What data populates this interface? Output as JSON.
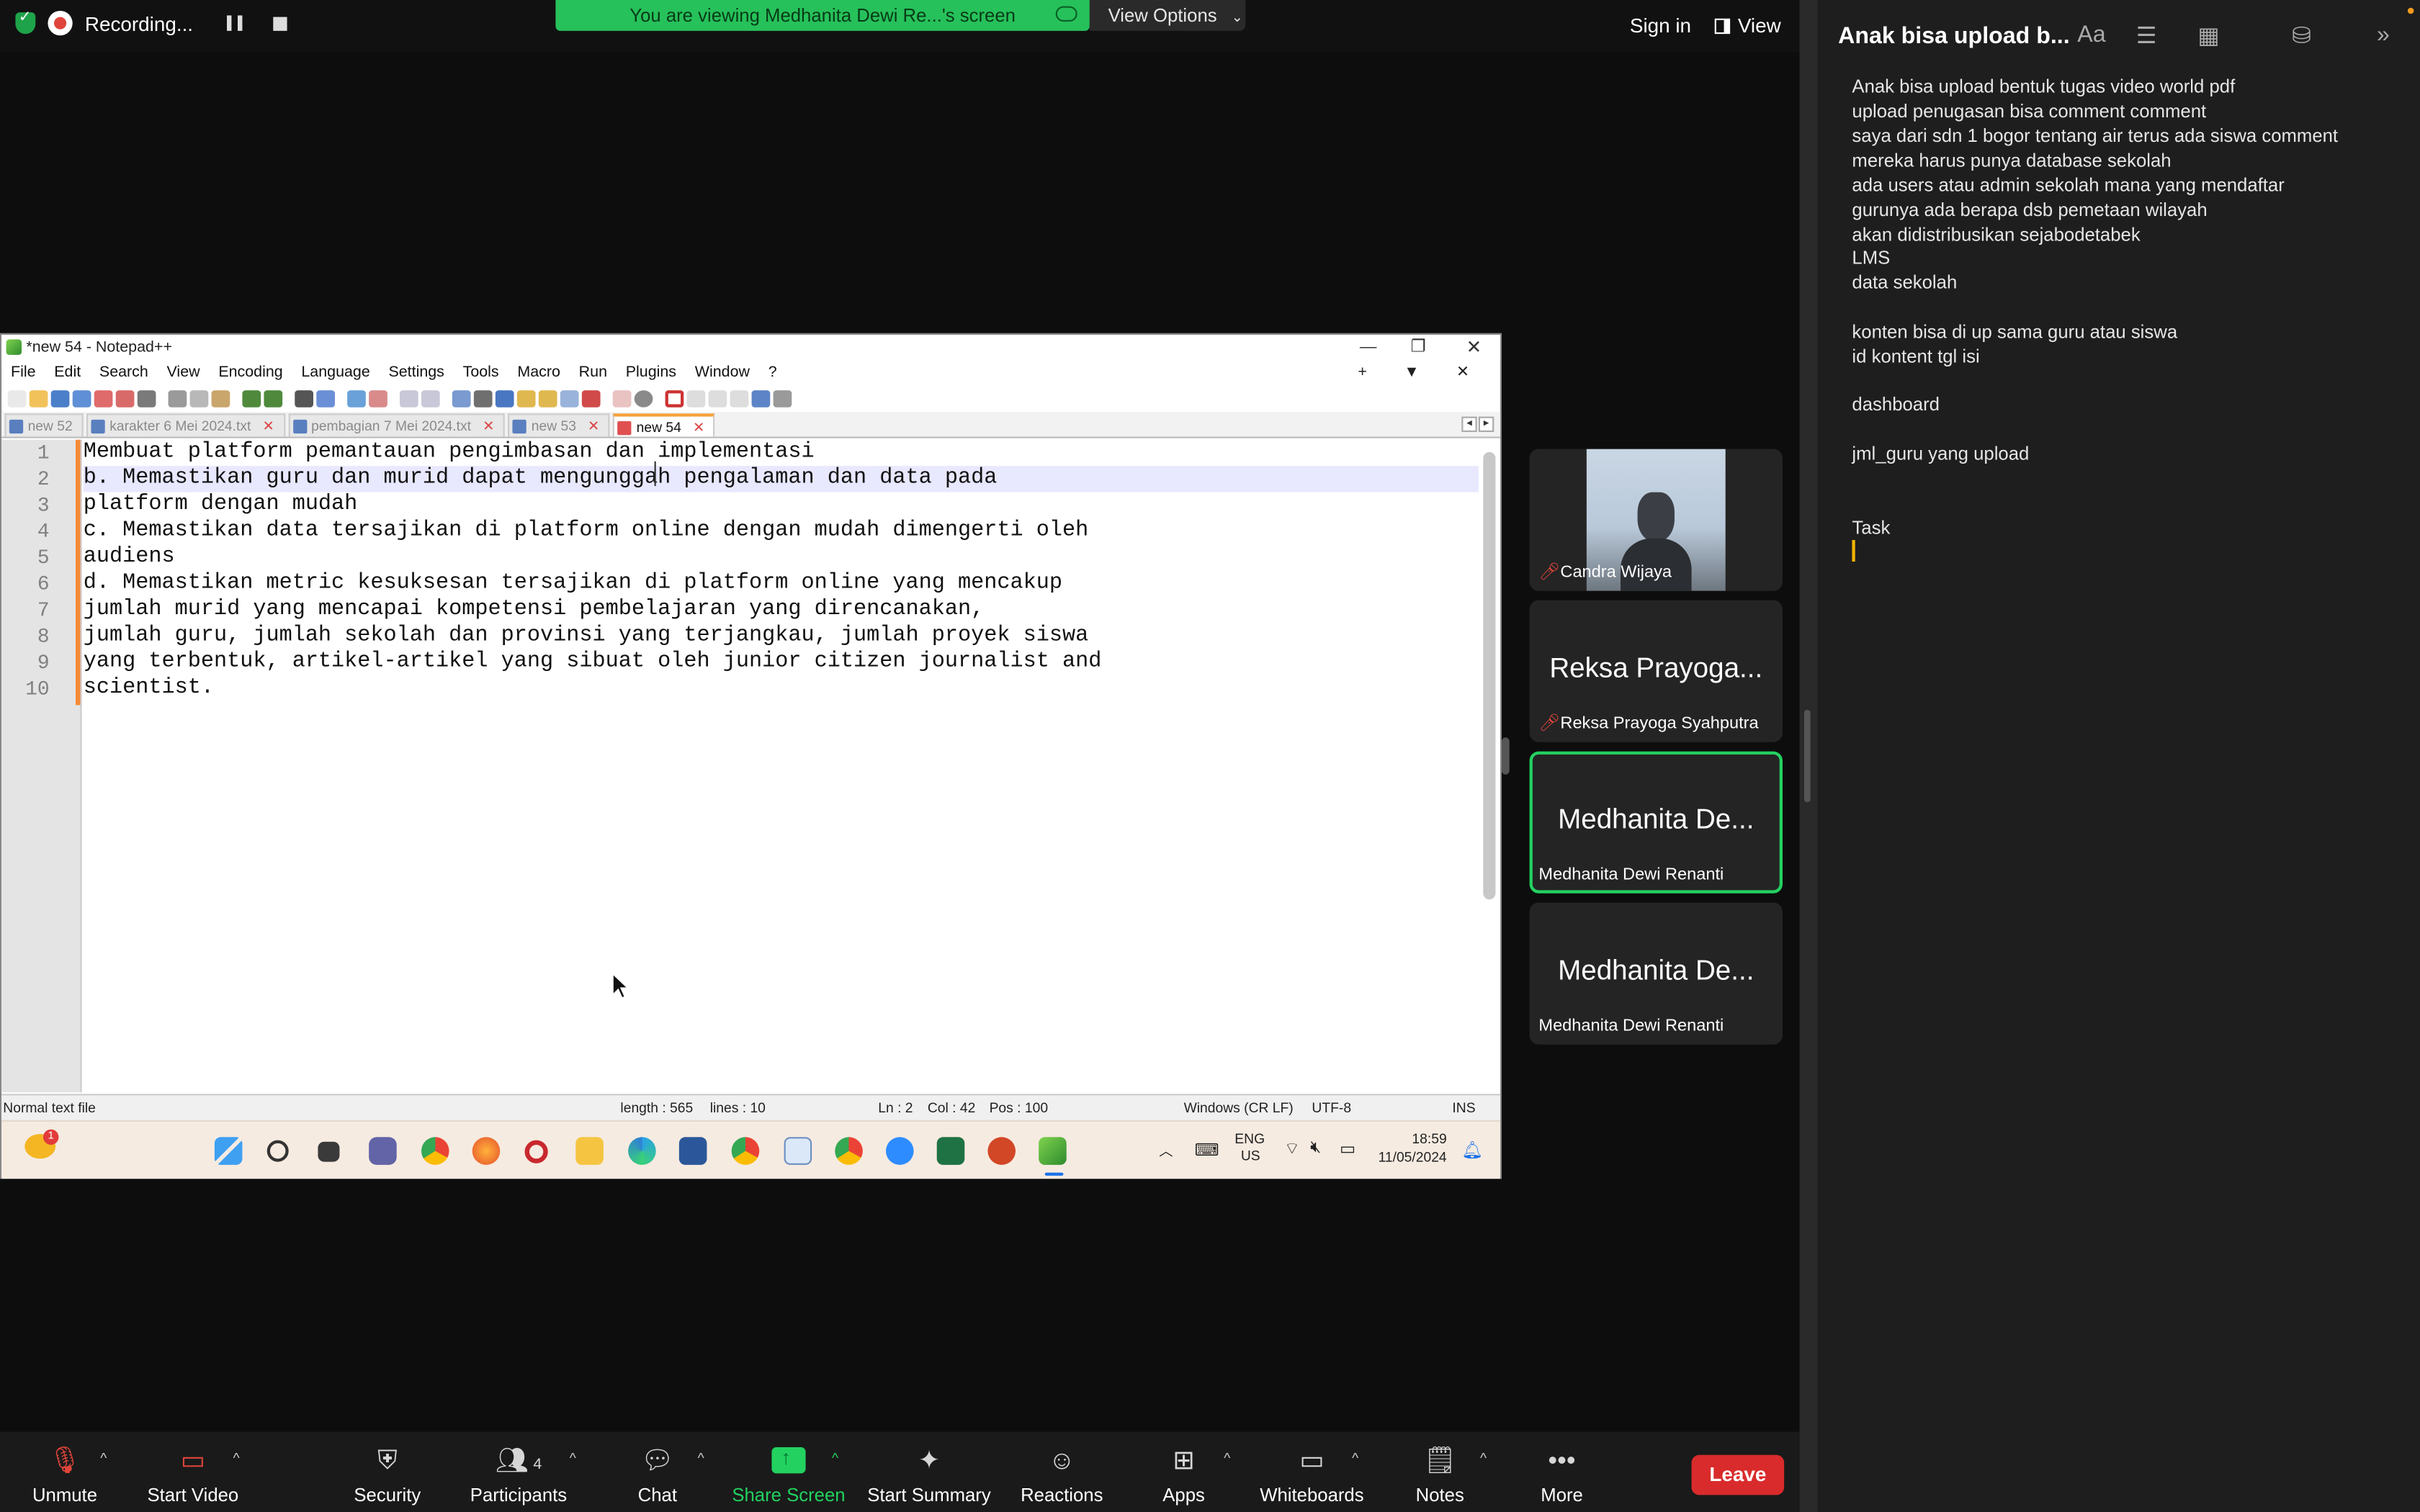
{
  "topbar": {
    "recording_label": "Recording...",
    "share_banner": "You are viewing Medhanita Dewi Re...'s screen",
    "view_options": "View Options",
    "sign_in": "Sign in",
    "view": "View"
  },
  "notepad": {
    "window_title": "*new 54 - Notepad++",
    "menu": [
      "File",
      "Edit",
      "Search",
      "View",
      "Encoding",
      "Language",
      "Settings",
      "Tools",
      "Macro",
      "Run",
      "Plugins",
      "Window",
      "?"
    ],
    "tabs": [
      "new 52",
      "karakter 6 Mei 2024.txt",
      "pembagian 7 Mei 2024.txt",
      "new 53",
      "new 54"
    ],
    "line_numbers": [
      "1",
      "2",
      "3",
      "4",
      "5",
      "6",
      "7",
      "8",
      "9",
      "10"
    ],
    "lines": [
      "Membuat platform pemantauan pengimbasan dan implementasi",
      "b. Memastikan guru dan murid dapat mengunggah pengalaman dan data pada",
      "platform dengan mudah",
      "c. Memastikan data tersajikan di platform online dengan mudah dimengerti oleh",
      "audiens",
      "d. Memastikan metric kesuksesan tersajikan di platform online yang mencakup",
      "jumlah murid yang mencapai kompetensi pembelajaran yang direncanakan,",
      "jumlah guru, jumlah sekolah dan provinsi yang terjangkau, jumlah proyek siswa",
      "yang terbentuk, artikel-artikel yang sibuat oleh junior citizen journalist and",
      "scientist."
    ],
    "status": {
      "file_type": "Normal text file",
      "length": "length : 565",
      "lines": "lines : 10",
      "ln": "Ln : 2",
      "col": "Col : 42",
      "pos": "Pos : 100",
      "eol": "Windows (CR LF)",
      "encoding": "UTF-8",
      "mode": "INS"
    }
  },
  "taskbar": {
    "weather_badge": "1",
    "lang_top": "ENG",
    "lang_bottom": "US",
    "time": "18:59",
    "date": "11/05/2024"
  },
  "participants": [
    {
      "label": "Candra Wijaya",
      "big": ""
    },
    {
      "label": "Reksa Prayoga Syahputra",
      "big": "Reksa Prayoga..."
    },
    {
      "label": "Medhanita Dewi Renanti",
      "big": "Medhanita De..."
    },
    {
      "label": "Medhanita Dewi Renanti",
      "big": "Medhanita De..."
    }
  ],
  "toolbar": {
    "unmute": "Unmute",
    "start_video": "Start Video",
    "security": "Security",
    "participants": "Participants",
    "participant_count": "4",
    "chat": "Chat",
    "share_screen": "Share Screen",
    "start_summary": "Start Summary",
    "reactions": "Reactions",
    "apps": "Apps",
    "whiteboards": "Whiteboards",
    "notes": "Notes",
    "more": "More",
    "leave": "Leave"
  },
  "notes": {
    "title": "Anak bisa upload b...",
    "font_icon": "Aa",
    "lines": [
      "Anak bisa upload bentuk tugas video world pdf",
      "upload penugasan bisa comment comment",
      "saya dari sdn 1 bogor tentang air terus ada siswa comment",
      "mereka harus punya database sekolah",
      "ada users atau admin sekolah mana yang mendaftar",
      "gurunya ada berapa dsb pemetaan wilayah",
      "akan didistribusikan sejabodetabek",
      "LMS",
      "data sekolah",
      "",
      "konten bisa di up sama guru atau siswa",
      "id kontent tgl isi",
      "",
      "dashboard",
      "",
      "jml_guru yang upload",
      "",
      "",
      "Task"
    ]
  }
}
